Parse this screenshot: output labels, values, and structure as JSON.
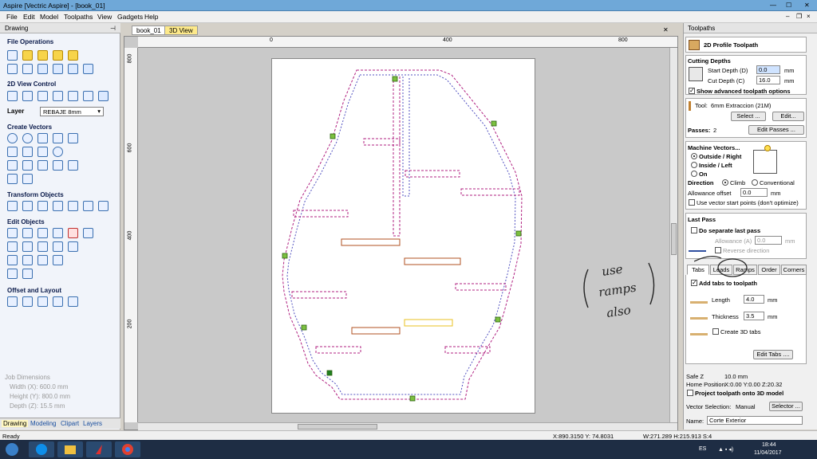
{
  "window": {
    "title": "Aspire [Vectric Aspire] - [book_01]"
  },
  "menu": [
    "File",
    "Edit",
    "Model",
    "Toolpaths",
    "View",
    "Gadgets",
    "Help"
  ],
  "left_panel": {
    "title": "Drawing",
    "sections": {
      "file_ops": "File Operations",
      "view_ctrl": "2D View Control",
      "create_vectors": "Create Vectors",
      "transform": "Transform Objects",
      "edit_objects": "Edit Objects",
      "offset_layout": "Offset and Layout"
    },
    "layer_label": "Layer",
    "layer_value": "REBAJE 8mm",
    "job_dimensions": {
      "title": "Job Dimensions",
      "width": "Width  (X): 600.0 mm",
      "height": "Height (Y): 800.0 mm",
      "depth": "Depth  (Z): 15.5 mm"
    },
    "tabs": [
      "Drawing",
      "Modeling",
      "Clipart",
      "Layers"
    ]
  },
  "document_tabs": [
    "book_01",
    "3D View"
  ],
  "rulers": {
    "h": [
      "0",
      "400",
      "800"
    ],
    "v": [
      "800",
      "600",
      "400",
      "200"
    ]
  },
  "toolpaths_panel": {
    "title": "Toolpaths",
    "header": "2D Profile Toolpath",
    "cutting_depths": "Cutting Depths",
    "start_depth_label": "Start Depth (D)",
    "start_depth": "0.0",
    "cut_depth_label": "Cut Depth (C)",
    "cut_depth": "16.0",
    "unit": "mm",
    "show_advanced": "Show advanced toolpath options",
    "tool_label": "Tool:",
    "tool_name": "6mm Extraccion (21M)",
    "select_btn": "Select ...",
    "edit_btn": "Edit...",
    "passes_label": "Passes:",
    "passes": "2",
    "edit_passes_btn": "Edit Passes ...",
    "machine_vectors": "Machine Vectors...",
    "outside_right": "Outside / Right",
    "inside_left": "Inside / Left",
    "on": "On",
    "direction": "Direction",
    "climb": "Climb",
    "conventional": "Conventional",
    "allowance_label": "Allowance offset",
    "allowance": "0.0",
    "use_vector_start": "Use vector start points (don't optimize)",
    "last_pass": "Last Pass",
    "do_separate": "Do separate last pass",
    "allowance_a": "Allowance (A)",
    "allowance_a_val": "0.0",
    "reverse_dir": "Reverse direction",
    "tabs": [
      "Tabs",
      "Leads",
      "Ramps",
      "Order",
      "Corners"
    ],
    "add_tabs": "Add tabs to toolpath",
    "length_label": "Length",
    "length": "4.0",
    "thickness_label": "Thickness",
    "thickness": "3.5",
    "create_3d_tabs": "Create 3D tabs",
    "edit_tabs_btn": "Edit Tabs ....",
    "safe_z": "Safe Z",
    "safe_z_val": "10.0 mm",
    "home_label": "Home Position",
    "home_val": "X:0.00 Y:0.00 Z:20.32",
    "project": "Project toolpath onto 3D model",
    "vector_sel_label": "Vector Selection:",
    "vector_sel": "Manual",
    "selector_btn": "Selector ...",
    "name_label": "Name:",
    "name_val": "Corte Exterior"
  },
  "annotation": {
    "line1": "use",
    "line2": "ramps",
    "line3": "also"
  },
  "status": {
    "ready": "Ready",
    "coords": "X:890.3150 Y: 74.8031",
    "size": "W:271.289  H:215.913  S:4"
  },
  "taskbar": {
    "lang": "ES",
    "time": "18:44",
    "date": "11/04/2017"
  }
}
